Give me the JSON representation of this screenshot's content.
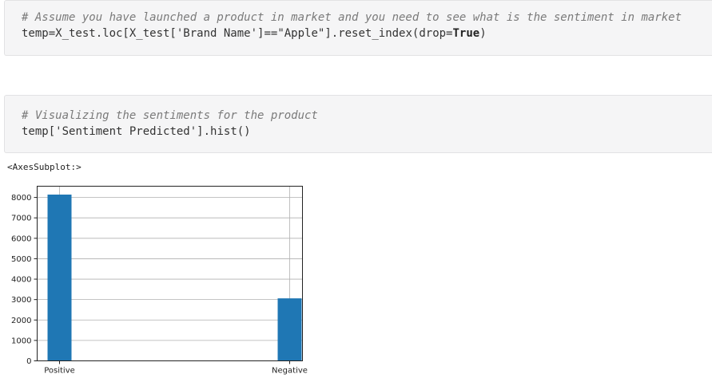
{
  "cells": [
    {
      "comment": "# Assume you have launched a product in market and you need to see what is the sentiment in market",
      "code": {
        "part1": "temp=X_test.loc[X_test[",
        "part2": "'Brand Name'",
        "part3": "]==",
        "part4": "\"Apple\"",
        "part5": "].reset_index(drop=",
        "part6": "True",
        "part7": ")"
      }
    },
    {
      "comment": "# Visualizing the sentiments for the product",
      "code": {
        "part1": "temp[",
        "part2": "'Sentiment Predicted'",
        "part3": "].",
        "part4": "hist",
        "part5": "()"
      }
    }
  ],
  "output": {
    "repr": "<AxesSubplot:>"
  },
  "chart_data": {
    "type": "bar",
    "categories": [
      "Positive",
      "Negative"
    ],
    "values": [
      8140,
      3060
    ],
    "yticks": [
      0,
      1000,
      2000,
      3000,
      4000,
      5000,
      6000,
      7000,
      8000
    ],
    "ylim": [
      0,
      8550
    ],
    "grid": true,
    "bar_color": "#1f77b4",
    "title": "",
    "xlabel": "",
    "ylabel": ""
  }
}
